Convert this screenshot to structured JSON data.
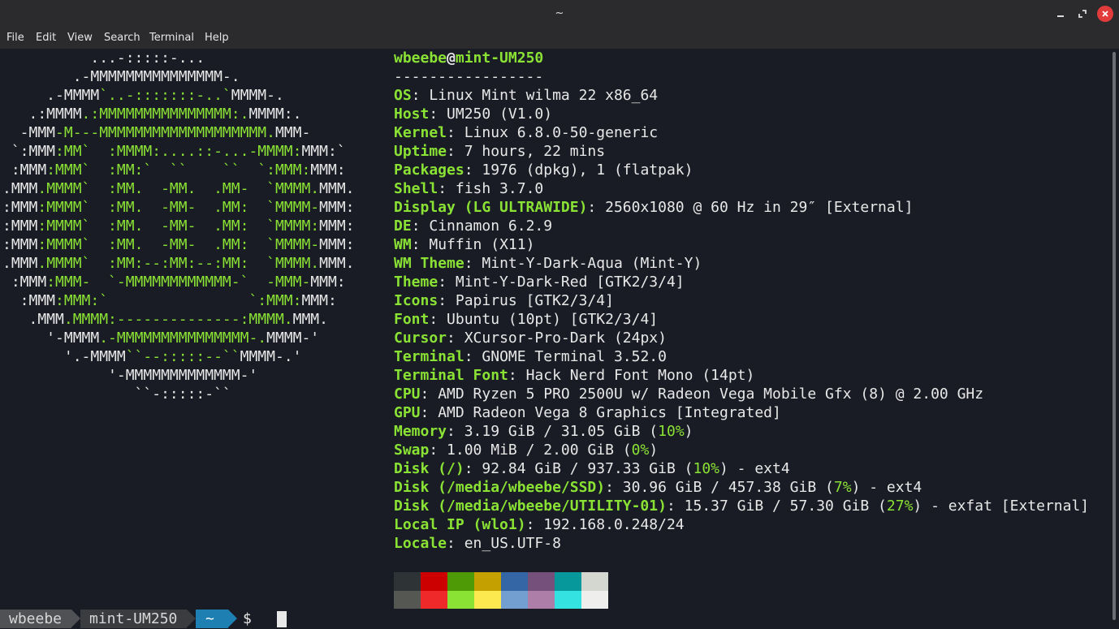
{
  "window": {
    "title": "~"
  },
  "menu": {
    "items": [
      "File",
      "Edit",
      "View",
      "Search",
      "Terminal",
      "Help"
    ]
  },
  "ascii_logo": [
    [
      [
        "w",
        "          ...-:::::-..."
      ]
    ],
    [
      [
        "w",
        "        .-MMMMMMMMMMMMMMM-."
      ]
    ],
    [
      [
        "w",
        "     .-MMMM"
      ],
      [
        "g",
        "`..-:::::::-..`"
      ],
      [
        "w",
        "MMMM-."
      ]
    ],
    [
      [
        "w",
        "   .:MMMM"
      ],
      [
        "g",
        ".:MMMMMMMMMMMMMMM:."
      ],
      [
        "w",
        "MMMM:."
      ]
    ],
    [
      [
        "w",
        "  -MMM"
      ],
      [
        "g",
        "-M---MMMMMMMMMMMMMMMMMMM."
      ],
      [
        "w",
        "MMM-"
      ]
    ],
    [
      [
        "w",
        " `:MMM"
      ],
      [
        "g",
        ":MM`  :MMMM:....::-...-MMMM:"
      ],
      [
        "w",
        "MMM:`"
      ]
    ],
    [
      [
        "w",
        " :MMM"
      ],
      [
        "g",
        ":MMM`  :MM:`  ``    ``  `:MMM:"
      ],
      [
        "w",
        "MMM:"
      ]
    ],
    [
      [
        "w",
        ".MMM"
      ],
      [
        "g",
        ".MMMM`  :MM.  -MM.  .MM-  `MMMM."
      ],
      [
        "w",
        "MMM."
      ]
    ],
    [
      [
        "w",
        ":MMM"
      ],
      [
        "g",
        ":MMMM`  :MM.  -MM-  .MM:  `MMMM-"
      ],
      [
        "w",
        "MMM:"
      ]
    ],
    [
      [
        "w",
        ":MMM"
      ],
      [
        "g",
        ":MMMM`  :MM.  -MM-  .MM:  `MMMM:"
      ],
      [
        "w",
        "MMM:"
      ]
    ],
    [
      [
        "w",
        ":MMM"
      ],
      [
        "g",
        ":MMMM`  :MM.  -MM-  .MM:  `MMMM-"
      ],
      [
        "w",
        "MMM:"
      ]
    ],
    [
      [
        "w",
        ".MMM"
      ],
      [
        "g",
        ".MMMM`  :MM:--:MM:--:MM:  `MMMM."
      ],
      [
        "w",
        "MMM."
      ]
    ],
    [
      [
        "w",
        " :MMM"
      ],
      [
        "g",
        ":MMM-  `-MMMMMMMMMMMM-`  -MMM-"
      ],
      [
        "w",
        "MMM:"
      ]
    ],
    [
      [
        "w",
        "  :MMM"
      ],
      [
        "g",
        ":MMM:`                `:MMM:"
      ],
      [
        "w",
        "MMM:"
      ]
    ],
    [
      [
        "w",
        "   .MMM"
      ],
      [
        "g",
        ".MMMM:--------------:MMMM."
      ],
      [
        "w",
        "MMM."
      ]
    ],
    [
      [
        "w",
        "     '-MMMM"
      ],
      [
        "g",
        ".-MMMMMMMMMMMMMMM-."
      ],
      [
        "w",
        "MMMM-'"
      ]
    ],
    [
      [
        "w",
        "       '.-MMMM"
      ],
      [
        "g",
        "``--:::::--``"
      ],
      [
        "w",
        "MMMM-.'"
      ]
    ],
    [
      [
        "w",
        "            '-MMMMMMMMMMMMM-'"
      ]
    ],
    [
      [
        "w",
        "               ``-:::::-``"
      ]
    ]
  ],
  "header": {
    "user": "wbeebe",
    "at": "@",
    "host": "mint-UM250",
    "rule": "-----------------"
  },
  "info": [
    {
      "label": "OS",
      "value": "Linux Mint wilma 22 x86_64"
    },
    {
      "label": "Host",
      "value": "UM250 (V1.0)"
    },
    {
      "label": "Kernel",
      "value": "Linux 6.8.0-50-generic"
    },
    {
      "label": "Uptime",
      "value": "7 hours, 22 mins"
    },
    {
      "label": "Packages",
      "value": "1976 (dpkg), 1 (flatpak)"
    },
    {
      "label": "Shell",
      "value": "fish 3.7.0"
    },
    {
      "label": "Display (LG ULTRAWIDE)",
      "value": "2560x1080 @ 60 Hz in 29″ [External]"
    },
    {
      "label": "DE",
      "value": "Cinnamon 6.2.9"
    },
    {
      "label": "WM",
      "value": "Muffin (X11)"
    },
    {
      "label": "WM Theme",
      "value": "Mint-Y-Dark-Aqua (Mint-Y)"
    },
    {
      "label": "Theme",
      "value": "Mint-Y-Dark-Red [GTK2/3/4]"
    },
    {
      "label": "Icons",
      "value": "Papirus [GTK2/3/4]"
    },
    {
      "label": "Font",
      "value": "Ubuntu (10pt) [GTK2/3/4]"
    },
    {
      "label": "Cursor",
      "value": "XCursor-Pro-Dark (24px)"
    },
    {
      "label": "Terminal",
      "value": "GNOME Terminal 3.52.0"
    },
    {
      "label": "Terminal Font",
      "value": "Hack Nerd Font Mono (14pt)"
    },
    {
      "label": "CPU",
      "value": "AMD Ryzen 5 PRO 2500U w/ Radeon Vega Mobile Gfx (8) @ 2.00 GHz"
    },
    {
      "label": "GPU",
      "value": "AMD Radeon Vega 8 Graphics [Integrated]"
    },
    {
      "label": "Memory",
      "value": "3.19 GiB / 31.05 GiB (",
      "pct": "10%",
      "tail": ")"
    },
    {
      "label": "Swap",
      "value": "1.00 MiB / 2.00 GiB (",
      "pct": "0%",
      "tail": ")"
    },
    {
      "label": "Disk (/)",
      "value": "92.84 GiB / 937.33 GiB (",
      "pct": "10%",
      "tail": ") - ext4"
    },
    {
      "label": "Disk (/media/wbeebe/SSD)",
      "value": "30.96 GiB / 457.38 GiB (",
      "pct": "7%",
      "tail": ") - ext4"
    },
    {
      "label": "Disk (/media/wbeebe/UTILITY-01)",
      "value": "15.37 GiB / 57.30 GiB (",
      "pct": "27%",
      "tail": ") - exfat [External]"
    },
    {
      "label": "Local IP (wlo1)",
      "value": "192.168.0.248/24"
    },
    {
      "label": "Locale",
      "value": "en_US.UTF-8"
    }
  ],
  "palette": {
    "normal": [
      "#2e3436",
      "#cc0000",
      "#4e9a06",
      "#c4a000",
      "#3465a4",
      "#75507b",
      "#06989a",
      "#d3d7cf"
    ],
    "bright": [
      "#555753",
      "#ef2929",
      "#8ae234",
      "#fce94f",
      "#729fcf",
      "#ad7fa8",
      "#34e2e2",
      "#eeeeec"
    ]
  },
  "prompt": {
    "user": "wbeebe",
    "host": "mint-UM250",
    "dir": "~",
    "symbol": "$"
  }
}
